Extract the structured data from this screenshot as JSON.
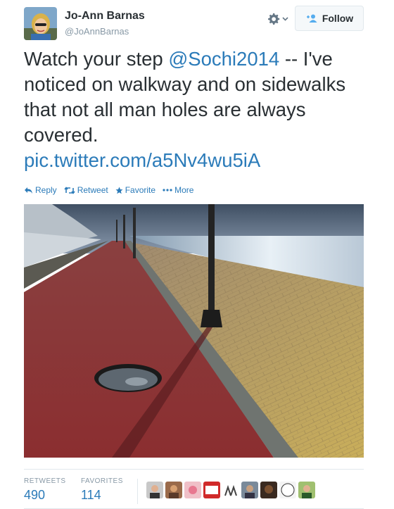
{
  "user": {
    "name": "Jo-Ann Barnas",
    "handle": "@JoAnnBarnas"
  },
  "header": {
    "follow_label": "Follow",
    "follow_icon": "add-user-icon",
    "settings_icon": "gear-icon"
  },
  "tweet": {
    "text_1": "Watch your step ",
    "mention": "@Sochi2014",
    "text_2": " -- I've noticed on walkway and on sidewalks that not all man holes are always covered.",
    "link": "pic.twitter.com/a5Nv4wu5iA"
  },
  "actions": [
    {
      "label": "Reply",
      "icon": "reply-icon"
    },
    {
      "label": "Retweet",
      "icon": "retweet-icon"
    },
    {
      "label": "Favorite",
      "icon": "star-icon"
    },
    {
      "label": "More",
      "icon": "more-dots-icon"
    }
  ],
  "stats": {
    "retweets_label": "RETWEETS",
    "retweets_value": "490",
    "favorites_label": "FAVORITES",
    "favorites_value": "114"
  },
  "colors": {
    "link": "#2b7bb9",
    "text": "#292f33",
    "muted": "#8899a6",
    "border": "#e1e8ed"
  }
}
